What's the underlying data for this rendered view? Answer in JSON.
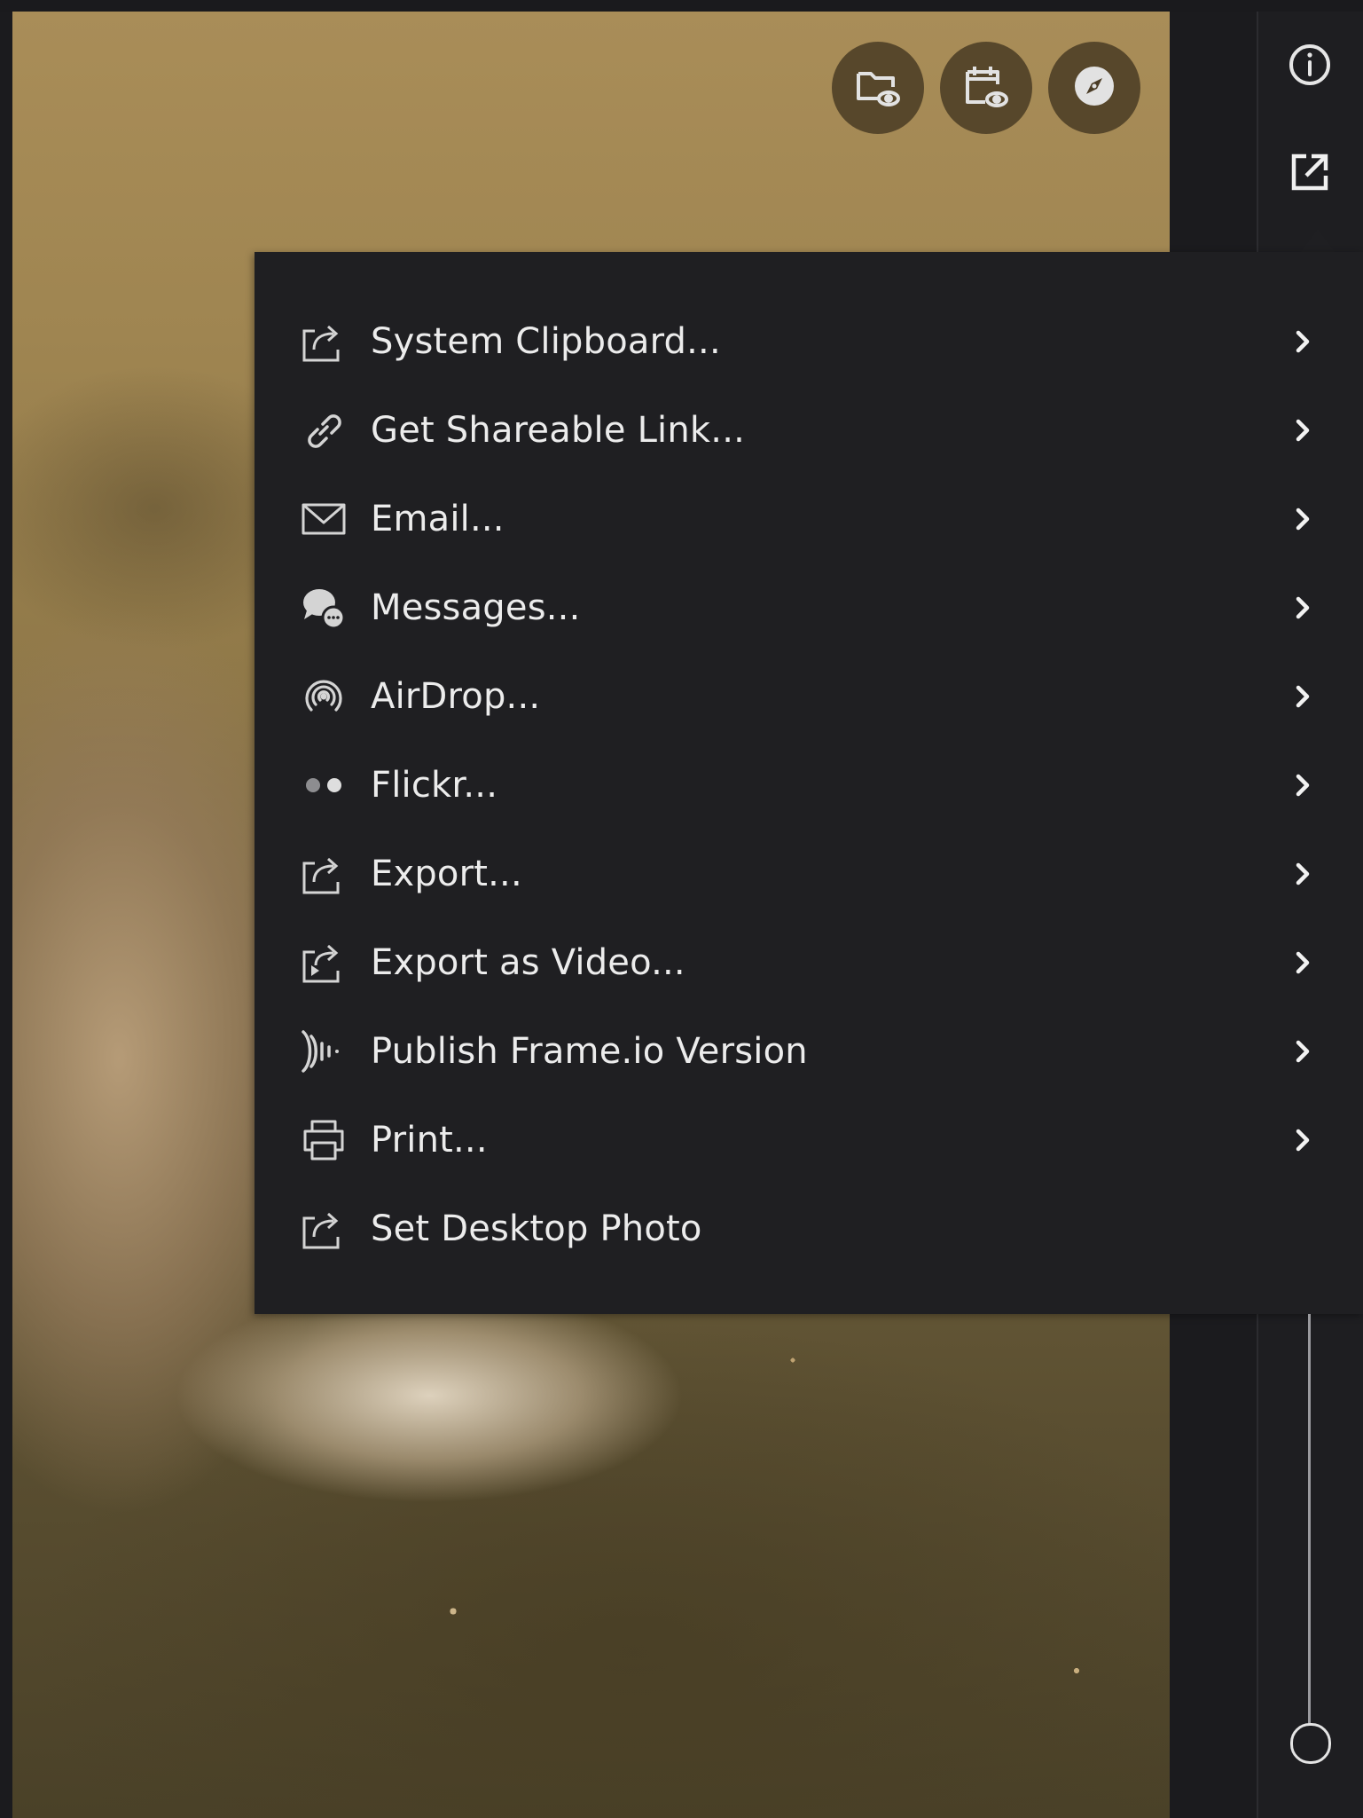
{
  "viewer": {
    "actions": [
      {
        "name": "show-in-folder",
        "icon": "folder-eye-icon"
      },
      {
        "name": "show-in-calendar",
        "icon": "calendar-eye-icon"
      },
      {
        "name": "show-on-map",
        "icon": "compass-icon"
      }
    ]
  },
  "sidebar": {
    "info_icon": "info-icon",
    "share_icon": "share-icon",
    "zoom_level": 1.0
  },
  "share_menu": {
    "items": [
      {
        "label": "System Clipboard...",
        "icon": "share-arrow-icon",
        "has_submenu": true
      },
      {
        "label": "Get Shareable Link...",
        "icon": "link-icon",
        "has_submenu": true
      },
      {
        "label": "Email...",
        "icon": "envelope-icon",
        "has_submenu": true
      },
      {
        "label": "Messages...",
        "icon": "messages-icon",
        "has_submenu": true
      },
      {
        "label": "AirDrop...",
        "icon": "airdrop-icon",
        "has_submenu": true
      },
      {
        "label": "Flickr...",
        "icon": "flickr-icon",
        "has_submenu": true
      },
      {
        "label": "Export...",
        "icon": "share-arrow-icon",
        "has_submenu": true
      },
      {
        "label": "Export as Video...",
        "icon": "export-video-icon",
        "has_submenu": true
      },
      {
        "label": "Publish Frame.io Version",
        "icon": "frameio-icon",
        "has_submenu": true
      },
      {
        "label": "Print...",
        "icon": "printer-icon",
        "has_submenu": true
      },
      {
        "label": "Set Desktop Photo",
        "icon": "share-arrow-icon",
        "has_submenu": false
      }
    ]
  },
  "colors": {
    "menu_bg": "#1f1f22",
    "menu_text": "#ececec",
    "icon": "#d8d8d8",
    "action_button_bg": "#46382266"
  }
}
